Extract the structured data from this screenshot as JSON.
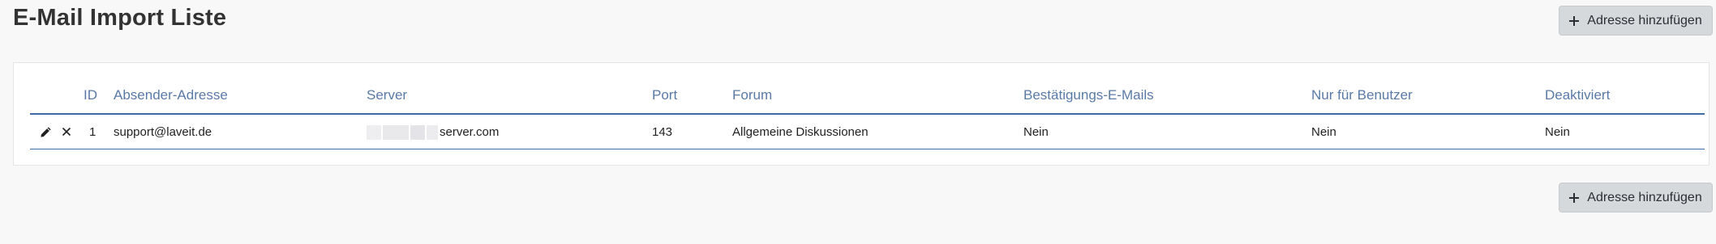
{
  "page": {
    "title": "E-Mail Import Liste"
  },
  "actions": {
    "add_label": "Adresse hinzufügen",
    "add_icon": "plus-icon"
  },
  "table": {
    "columns": [
      "ID",
      "Absender-Adresse",
      "Server",
      "Port",
      "Forum",
      "Bestätigungs-E-Mails",
      "Nur für Benutzer",
      "Deaktiviert"
    ],
    "rows": [
      {
        "id": "1",
        "sender": "support@laveit.de",
        "server": "server.com",
        "port": "143",
        "forum": "Allgemeine Diskussionen",
        "confirmation_emails": "Nein",
        "users_only": "Nein",
        "deactivated": "Nein",
        "row_icons": [
          "pencil-icon",
          "close-icon"
        ]
      }
    ]
  },
  "colors": {
    "header_text": "#5a7aa6",
    "rule": "#3e6aa6",
    "button_bg": "#d6d9dc"
  }
}
